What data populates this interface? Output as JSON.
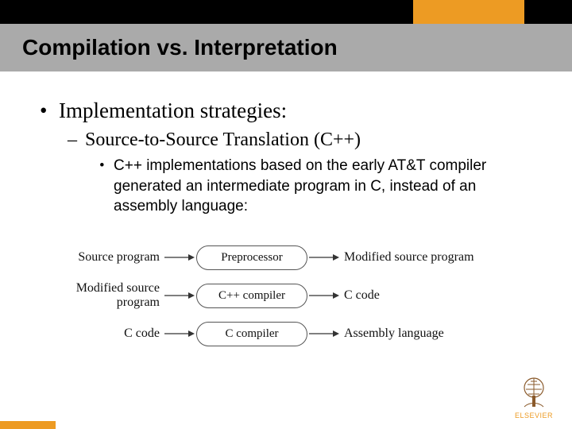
{
  "header": {
    "title": "Compilation vs. Interpretation"
  },
  "bullets": {
    "lvl1": "Implementation strategies:",
    "lvl2": "Source-to-Source Translation (C++)",
    "lvl3": "C++ implementations based on the early AT&T compiler generated an intermediate program in C, instead of an assembly language:"
  },
  "diagram": {
    "rows": [
      {
        "left": "Source program",
        "box": "Preprocessor",
        "right": "Modified source program"
      },
      {
        "left": "Modified source program",
        "box": "C++ compiler",
        "right": "C code"
      },
      {
        "left": "C code",
        "box": "C compiler",
        "right": "Assembly language"
      }
    ]
  },
  "logo": {
    "wordmark": "ELSEVIER"
  },
  "colors": {
    "accent": "#ed9b23",
    "titlebar": "#aaaaaa"
  }
}
